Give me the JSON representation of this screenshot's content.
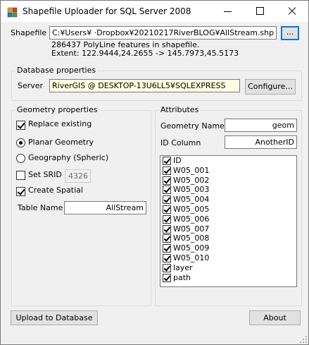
{
  "window": {
    "title": "Shapefile Uploader for SQL Server 2008"
  },
  "shapefile": {
    "label": "Shapefile",
    "path": "C:¥Users¥          ·Dropbox¥20210217RiverBLOG¥AllStream.shp",
    "browse_label": "...",
    "info_line1": "286437 PolyLine features in shapefile.",
    "info_line2": "Extent: 122.9444,24.2655 -> 145.7973,45.5173"
  },
  "database": {
    "group_title": "Database properties",
    "server_label": "Server",
    "server_value": "RiverGIS @ DESKTOP-13U6LL5¥SQLEXPRESS",
    "configure_label": "Configure..."
  },
  "geometry": {
    "group_title": "Geometry properties",
    "replace_existing": {
      "label": "Replace existing",
      "checked": true
    },
    "planar": {
      "label": "Planar Geometry",
      "selected": true
    },
    "geography": {
      "label": "Geography (Spheric)",
      "selected": false
    },
    "set_srid": {
      "label": "Set SRID",
      "checked": false,
      "value": "4326"
    },
    "create_spatial": {
      "label": "Create Spatial",
      "checked": true
    },
    "table_name_label": "Table Name",
    "table_name_value": "AllStream"
  },
  "attributes": {
    "group_title": "Attributes",
    "geometry_name_label": "Geometry Name",
    "geometry_name_value": "geom",
    "id_column_label": "ID Column",
    "id_column_value": "AnotherID",
    "items": [
      {
        "label": "ID",
        "checked": true
      },
      {
        "label": "W05_001",
        "checked": true
      },
      {
        "label": "W05_002",
        "checked": true
      },
      {
        "label": "W05_003",
        "checked": true
      },
      {
        "label": "W05_004",
        "checked": true
      },
      {
        "label": "W05_005",
        "checked": true
      },
      {
        "label": "W05_006",
        "checked": true
      },
      {
        "label": "W05_007",
        "checked": true
      },
      {
        "label": "W05_008",
        "checked": true
      },
      {
        "label": "W05_009",
        "checked": true
      },
      {
        "label": "W05_010",
        "checked": true
      },
      {
        "label": "layer",
        "checked": true
      },
      {
        "label": "path",
        "checked": true
      }
    ]
  },
  "footer": {
    "upload_label": "Upload to Database",
    "about_label": "About"
  }
}
